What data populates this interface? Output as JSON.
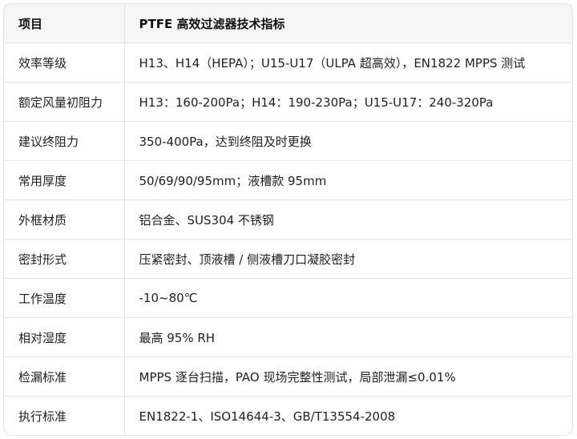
{
  "table": {
    "header": {
      "col1": "项目",
      "col2": "PTFE 高效过滤器技术指标"
    },
    "rows": [
      {
        "item": "效率等级",
        "value": "H13、H14（HEPA）；U15-U17（ULPA 超高效），EN1822 MPPS 测试"
      },
      {
        "item": "额定风量初阻力",
        "value": "H13：160-200Pa；H14：190-230Pa；U15-U17：240-320Pa"
      },
      {
        "item": "建议终阻力",
        "value": "350-400Pa，达到终阻及时更换"
      },
      {
        "item": "常用厚度",
        "value": "50/69/90/95mm；液槽款 95mm"
      },
      {
        "item": "外框材质",
        "value": "铝合金、SUS304 不锈钢"
      },
      {
        "item": "密封形式",
        "value": "压紧密封、顶液槽 / 侧液槽刀口凝胶密封"
      },
      {
        "item": "工作温度",
        "value": "-10~80℃"
      },
      {
        "item": "相对湿度",
        "value": "最高 95% RH"
      },
      {
        "item": "检漏标准",
        "value": "MPPS 逐台扫描，PAO 现场完整性测试，局部泄漏≤0.01%"
      },
      {
        "item": "执行标准",
        "value": "EN1822-1、ISO14644-3、GB/T13554-2008"
      }
    ]
  }
}
